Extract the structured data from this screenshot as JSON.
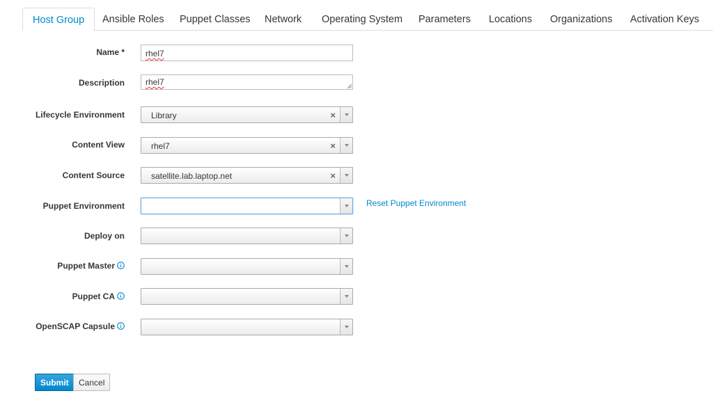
{
  "tabs": [
    {
      "label": "Host Group",
      "active": true
    },
    {
      "label": "Ansible Roles"
    },
    {
      "label": "Puppet Classes"
    },
    {
      "label": "Network"
    },
    {
      "label": "Operating System"
    },
    {
      "label": "Parameters"
    },
    {
      "label": "Locations"
    },
    {
      "label": "Organizations"
    },
    {
      "label": "Activation Keys"
    }
  ],
  "form": {
    "name": {
      "label": "Name *",
      "value": "rhel7"
    },
    "description": {
      "label": "Description",
      "value": "rhel7"
    },
    "lifecycle_environment": {
      "label": "Lifecycle Environment",
      "value": "Library"
    },
    "content_view": {
      "label": "Content View",
      "value": "rhel7"
    },
    "content_source": {
      "label": "Content Source",
      "value": "satellite.lab.laptop.net"
    },
    "puppet_environment": {
      "label": "Puppet Environment",
      "value": "",
      "link": "Reset Puppet Environment"
    },
    "deploy_on": {
      "label": "Deploy on",
      "value": ""
    },
    "puppet_master": {
      "label": "Puppet Master",
      "value": ""
    },
    "puppet_ca": {
      "label": "Puppet CA",
      "value": ""
    },
    "openscap_capsule": {
      "label": "OpenSCAP Capsule",
      "value": ""
    }
  },
  "buttons": {
    "submit": "Submit",
    "cancel": "Cancel"
  },
  "colors": {
    "accent": "#0088ce",
    "primary_button": "#0088ce"
  },
  "icons": {
    "info": "info-circle-icon",
    "clear": "clear-x-icon",
    "dropdown": "caret-down-icon"
  }
}
